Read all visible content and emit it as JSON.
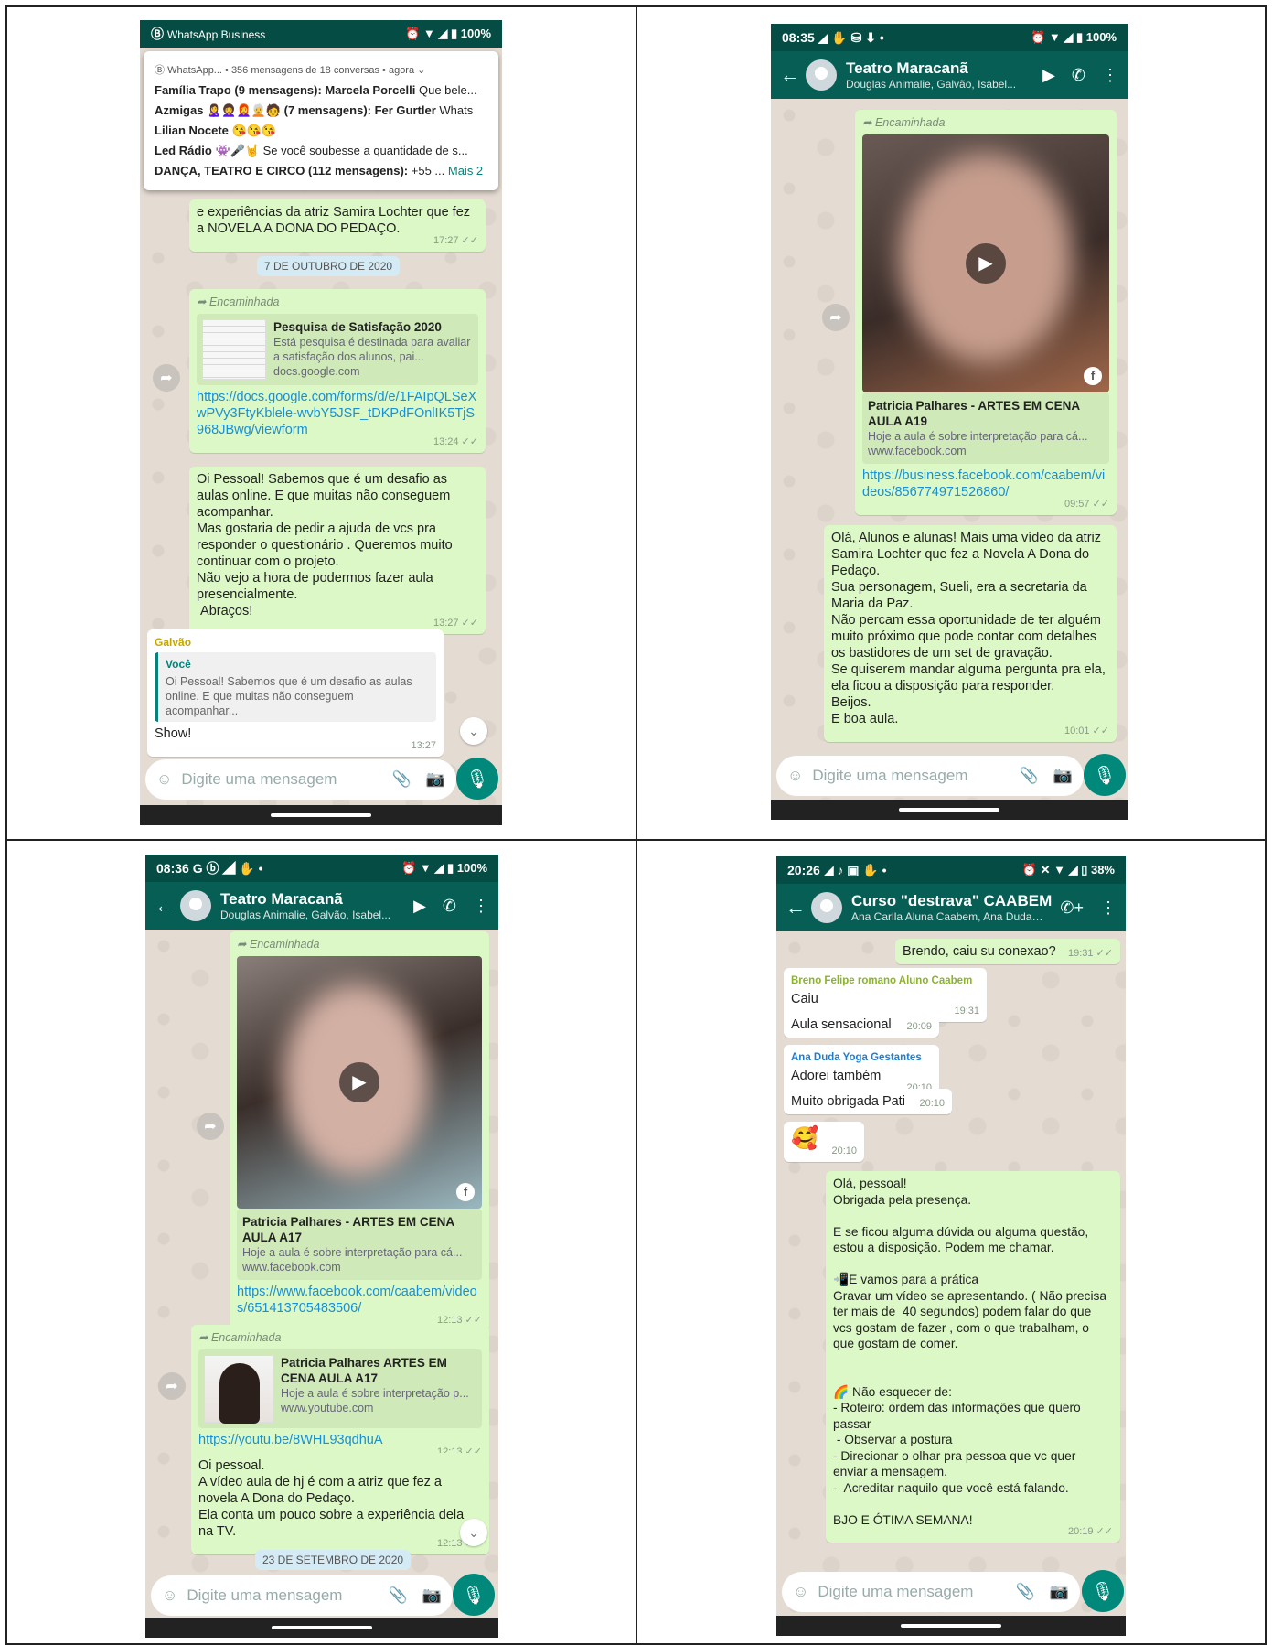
{
  "p1": {
    "status": {
      "app": "WhatsApp Business",
      "battery": "100%"
    },
    "notif": {
      "header": "WhatsApp... • 356 mensagens de 18 conversas • agora",
      "lines": [
        {
          "bold": "Família Trapo (9 mensagens): Marcela Porcelli",
          "rest": " Que bele..."
        },
        {
          "bold": "Azmigas 🙎‍♀️👩‍🦱👩‍🦰🧑‍🦳🧑 (7 mensagens): Fer Gurtler",
          "rest": " Whats"
        },
        {
          "bold": "Lilian Nocete",
          "rest": " 😘😘😘"
        },
        {
          "bold": "Led Rádio 👾🎤🤘",
          "rest": " Se você soubesse a quantidade de s..."
        },
        {
          "bold": "DANÇA, TEATRO E CIRCO (112 mensagens):",
          "rest": " +55 ... "
        }
      ],
      "more": "Mais 2"
    },
    "m0": {
      "text": "e experiências da atriz Samira Lochter que fez a NOVELA A DONA DO PEDAÇO.",
      "time": "17:27 ✓✓"
    },
    "date": "7 DE OUTUBRO DE 2020",
    "m1": {
      "fwd": "Encaminhada",
      "title": "Pesquisa de Satisfação 2020",
      "desc": "Está pesquisa é destinada para avaliar a satisfação dos alunos, pai...",
      "domain": "docs.google.com",
      "link": "https://docs.google.com/forms/d/e/1FAIpQLSeXwPVy3FtyKblele-wvbY5JSF_tDKPdFOnlIK5TjS968JBwg/viewform",
      "time": "13:24 ✓✓"
    },
    "m2": {
      "text": "Oi Pessoal! Sabemos que é um desafio as aulas online. E que muitas não conseguem acompanhar.\nMas gostaria de pedir a ajuda de vcs pra responder o questionário . Queremos muito continuar com o projeto.\nNão vejo a hora de podermos fazer aula presencialmente.\n Abraços!",
      "time": "13:27 ✓✓"
    },
    "m3": {
      "sender": "Galvão",
      "qname": "Você",
      "qtext": "Oi Pessoal! Sabemos que é um desafio as aulas online. E que muitas não conseguem acompanhar...",
      "text": "Show!",
      "time": "13:27"
    },
    "input": "Digite uma mensagem"
  },
  "p2": {
    "status": {
      "time": "08:35",
      "battery": "100%"
    },
    "head": {
      "name": "Teatro Maracanã",
      "sub": "Douglas Animalie, Galvão, Isabel..."
    },
    "m1": {
      "fwd": "Encaminhada",
      "title": "Patricia Palhares  - ARTES EM CENA AULA A19",
      "desc": "Hoje a aula é sobre interpretação para cá...",
      "domain": "www.facebook.com",
      "link": "https://business.facebook.com/caabem/videos/856774971526860/",
      "time": "09:57 ✓✓"
    },
    "m2": {
      "text": "Olá, Alunos e alunas! Mais uma vídeo da atriz Samira Lochter que fez a Novela A Dona do Pedaço.\nSua personagem, Sueli, era a secretaria da Maria da Paz.\nNão percam essa oportunidade de ter alguém muito próximo que pode contar com detalhes os bastidores de um set de gravação.\nSe quiserem mandar alguma pergunta pra ela, ela ficou a disposição para responder.\nBeijos.\nE boa aula.",
      "time": "10:01 ✓✓"
    },
    "input": "Digite uma mensagem"
  },
  "p3": {
    "status": {
      "time": "08:36",
      "battery": "100%"
    },
    "head": {
      "name": "Teatro Maracanã",
      "sub": "Douglas Animalie, Galvão, Isabel..."
    },
    "m1": {
      "fwd": "Encaminhada",
      "title": "Patricia Palhares  - ARTES EM CENA AULA A17",
      "desc": "Hoje a aula é sobre interpretação para cá...",
      "domain": "www.facebook.com",
      "link": "https://www.facebook.com/caabem/videos/651413705483506/",
      "time": "12:13 ✓✓"
    },
    "m2": {
      "fwd": "Encaminhada",
      "title": "Patricia Palhares ARTES EM CENA AULA A17",
      "desc": "Hoje a aula é sobre interpretação p...",
      "domain": "www.youtube.com",
      "link": "https://youtu.be/8WHL93qdhuA",
      "time": "12:13 ✓✓"
    },
    "m3": {
      "text": "Oi pessoal.\nA vídeo aula de hj é com a atriz que fez a novela A Dona do Pedaço.\nEla conta um pouco sobre a experiência dela na TV.",
      "time": "12:13 ✓✓"
    },
    "date": "23 DE SETEMBRO DE 2020",
    "input": "Digite uma mensagem"
  },
  "p4": {
    "status": {
      "time": "20:26",
      "battery": "38%"
    },
    "head": {
      "name": "Curso \"destrava\" CAABEM",
      "sub": "Ana Carlla Aluna Caabem, Ana Duda, Bre..."
    },
    "m1": {
      "text": "Brendo, caiu su conexao?",
      "time": "19:31 ✓✓"
    },
    "m2": {
      "sender": "Breno Felipe romano Aluno Caabem",
      "text": "Caiu",
      "time": "19:31"
    },
    "m3": {
      "text": "Aula sensacional",
      "time": "20:09"
    },
    "m4": {
      "sender": "Ana Duda Yoga Gestantes",
      "text": "Adorei também",
      "time": "20:10"
    },
    "m5": {
      "text": "Muito obrigada Pati",
      "time": "20:10"
    },
    "m6": {
      "text": "🥰",
      "time": "20:10"
    },
    "m7": {
      "text": "Olá, pessoal!\nObrigada pela presença.\n\nE se ficou alguma dúvida ou alguma questão, estou a disposição. Podem me chamar.\n\n📲E vamos para a prática\nGravar um vídeo se apresentando. ( Não precisa ter mais de  40 segundos) podem falar do que vcs gostam de fazer , com o que trabalham, o que gostam de comer.\n\n\n🌈 Não esquecer de:\n- Roteiro: ordem das informações que quero passar\n - Observar a postura\n- Direcionar o olhar pra pessoa que vc quer enviar a mensagem.\n-  Acreditar naquilo que você está falando.\n\nBJO E ÓTIMA SEMANA!",
      "time": "20:19 ✓✓"
    },
    "input": "Digite uma mensagem"
  }
}
